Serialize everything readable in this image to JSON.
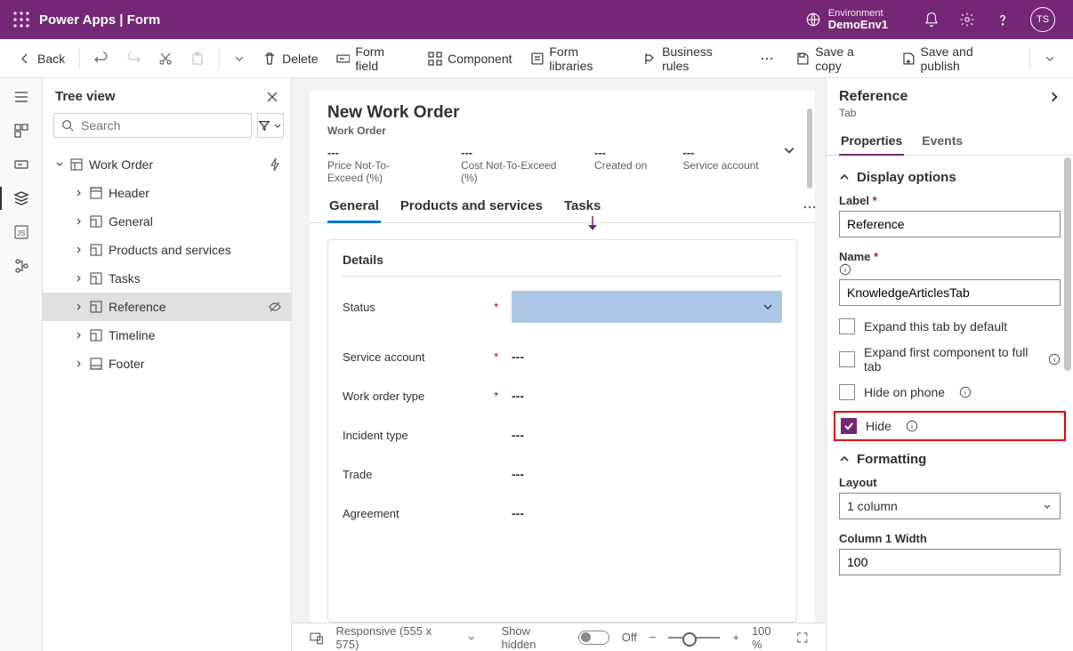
{
  "topbar": {
    "title": "Power Apps  |  Form",
    "env_label": "Environment",
    "env_value": "DemoEnv1",
    "avatar_initials": "TS"
  },
  "cmdbar": {
    "back": "Back",
    "delete": "Delete",
    "form_field": "Form field",
    "component": "Component",
    "form_libraries": "Form libraries",
    "business_rules": "Business rules",
    "save_copy": "Save a copy",
    "save_publish": "Save and publish"
  },
  "tree": {
    "title": "Tree view",
    "search_placeholder": "Search",
    "root": "Work Order",
    "nodes": [
      "Header",
      "General",
      "Products and services",
      "Tasks",
      "Reference",
      "Timeline",
      "Footer"
    ]
  },
  "form": {
    "title": "New Work Order",
    "subtitle": "Work Order",
    "summary": [
      {
        "value": "---",
        "label": "Price Not-To-Exceed (%)"
      },
      {
        "value": "---",
        "label": "Cost Not-To-Exceed (%)"
      },
      {
        "value": "---",
        "label": "Created on"
      },
      {
        "value": "---",
        "label": "Service account"
      }
    ],
    "tabs": [
      "General",
      "Products and services",
      "Tasks"
    ],
    "card_title": "Details",
    "fields": [
      {
        "label": "Status",
        "required": true,
        "value": "",
        "select": true
      },
      {
        "label": "Service account",
        "required": true,
        "value": "---"
      },
      {
        "label": "Work order type",
        "required": true,
        "value": "---"
      },
      {
        "label": "Incident type",
        "required": false,
        "value": "---"
      },
      {
        "label": "Trade",
        "required": false,
        "value": "---"
      },
      {
        "label": "Agreement",
        "required": false,
        "value": "---"
      }
    ]
  },
  "statusbar": {
    "responsive": "Responsive (555 x 575)",
    "show_hidden": "Show hidden",
    "toggle_label": "Off",
    "zoom": "100 %"
  },
  "props": {
    "title": "Reference",
    "subtitle": "Tab",
    "tabs": [
      "Properties",
      "Events"
    ],
    "display_options": "Display options",
    "label_lbl": "Label",
    "label_val": "Reference",
    "name_lbl": "Name",
    "name_val": "KnowledgeArticlesTab",
    "expand_default": "Expand this tab by default",
    "expand_full": "Expand first component to full tab",
    "hide_phone": "Hide on phone",
    "hide": "Hide",
    "formatting": "Formatting",
    "layout_lbl": "Layout",
    "layout_val": "1 column",
    "col_width_lbl": "Column 1 Width",
    "col_width_val": "100"
  }
}
